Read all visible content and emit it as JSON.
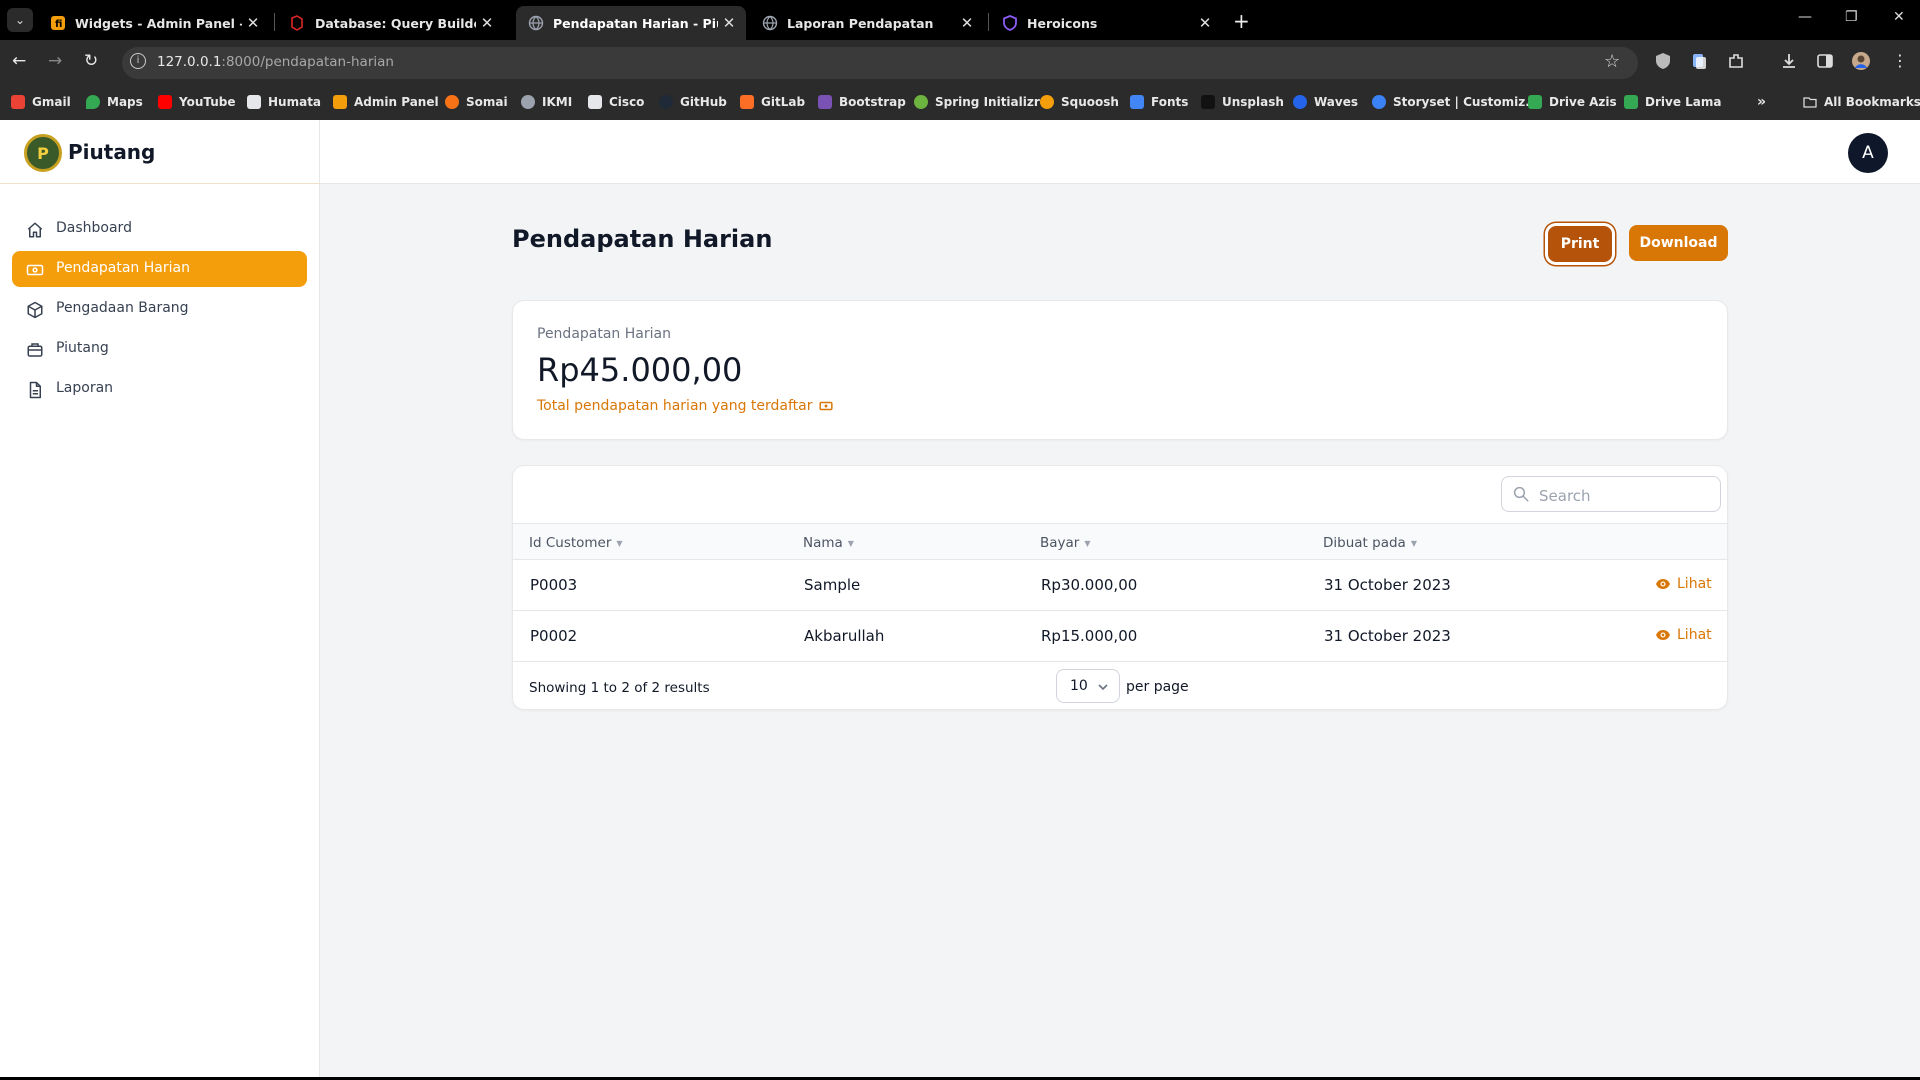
{
  "browser": {
    "tabs": [
      {
        "title": "Widgets - Admin Panel - Filam",
        "active": false,
        "favicon_color": "#f59e0b"
      },
      {
        "title": "Database: Query Builder - Lara",
        "active": false,
        "favicon_color": "#b91c1c"
      },
      {
        "title": "Pendapatan Harian - Piutang",
        "active": true,
        "favicon_color": "#9ca3af"
      },
      {
        "title": "Laporan Pendapatan",
        "active": false,
        "favicon_color": "#9ca3af"
      },
      {
        "title": "Heroicons",
        "active": false,
        "favicon_color": "#7c3aed"
      }
    ],
    "url_host": "127.0.0.1",
    "url_path": ":8000/pendapatan-harian",
    "bookmarks": [
      {
        "label": "Gmail",
        "color": "#ea4335"
      },
      {
        "label": "Maps",
        "color": "#34a853"
      },
      {
        "label": "YouTube",
        "color": "#ff0000"
      },
      {
        "label": "Humata",
        "color": "#e5e7eb"
      },
      {
        "label": "Admin Panel",
        "color": "#f59e0b"
      },
      {
        "label": "Somai",
        "color": "#f97316"
      },
      {
        "label": "IKMI",
        "color": "#9ca3af"
      },
      {
        "label": "Cisco",
        "color": "#e5e7eb"
      },
      {
        "label": "GitHub",
        "color": "#1f2937"
      },
      {
        "label": "GitLab",
        "color": "#fc6d26"
      },
      {
        "label": "Bootstrap",
        "color": "#7952b3"
      },
      {
        "label": "Spring Initializr",
        "color": "#6db33f"
      },
      {
        "label": "Squoosh",
        "color": "#f59e0b"
      },
      {
        "label": "Fonts",
        "color": "#4285f4"
      },
      {
        "label": "Unsplash",
        "color": "#111111"
      },
      {
        "label": "Waves",
        "color": "#2563eb"
      },
      {
        "label": "Storyset | Customiz...",
        "color": "#3b82f6"
      },
      {
        "label": "Drive Azis",
        "color": "#34a853"
      },
      {
        "label": "Drive Lama",
        "color": "#34a853"
      }
    ],
    "all_bookmarks": "All Bookmarks"
  },
  "app": {
    "brand": "Piutang",
    "avatar_initial": "A",
    "accent_color": "#f59e0b",
    "nav": [
      {
        "label": "Dashboard",
        "icon": "home-icon",
        "active": false
      },
      {
        "label": "Pendapatan Harian",
        "icon": "cash-icon",
        "active": true
      },
      {
        "label": "Pengadaan Barang",
        "icon": "cube-icon",
        "active": false
      },
      {
        "label": "Piutang",
        "icon": "briefcase-icon",
        "active": false
      },
      {
        "label": "Laporan",
        "icon": "document-icon",
        "active": false
      }
    ]
  },
  "page": {
    "title": "Pendapatan Harian",
    "print_label": "Print",
    "download_label": "Download"
  },
  "stat": {
    "label": "Pendapatan Harian",
    "value": "Rp45.000,00",
    "description": "Total pendapatan harian yang terdaftar"
  },
  "table": {
    "search_placeholder": "Search",
    "columns": [
      "Id Customer",
      "Nama",
      "Bayar",
      "Dibuat pada"
    ],
    "rows": [
      {
        "id": "P0003",
        "nama": "Sample",
        "bayar": "Rp30.000,00",
        "dibuat": "31 October 2023",
        "action": "Lihat"
      },
      {
        "id": "P0002",
        "nama": "Akbarullah",
        "bayar": "Rp15.000,00",
        "dibuat": "31 October 2023",
        "action": "Lihat"
      }
    ],
    "footer": "Showing 1 to 2 of 2 results",
    "per_page_value": "10",
    "per_page_label": "per page"
  }
}
